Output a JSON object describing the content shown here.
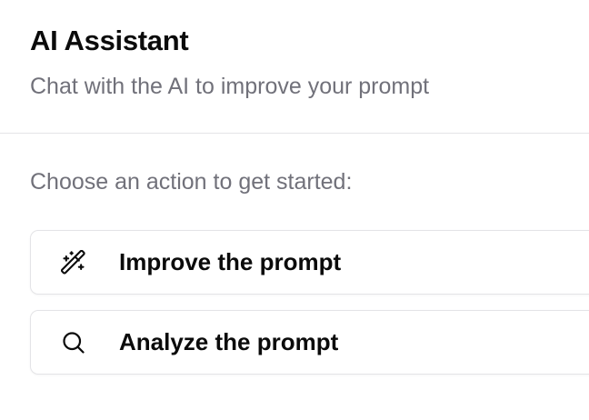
{
  "header": {
    "title": "AI Assistant",
    "subtitle": "Chat with the AI to improve your prompt"
  },
  "intro": {
    "label": "Choose an action to get started:"
  },
  "actions": [
    {
      "label": "Improve the prompt",
      "icon": "magic-wand-icon"
    },
    {
      "label": "Analyze the prompt",
      "icon": "search-icon"
    }
  ],
  "colors": {
    "text": "#0b0b0b",
    "muted": "#71717a",
    "border": "#e4e4e7",
    "background": "#ffffff"
  }
}
